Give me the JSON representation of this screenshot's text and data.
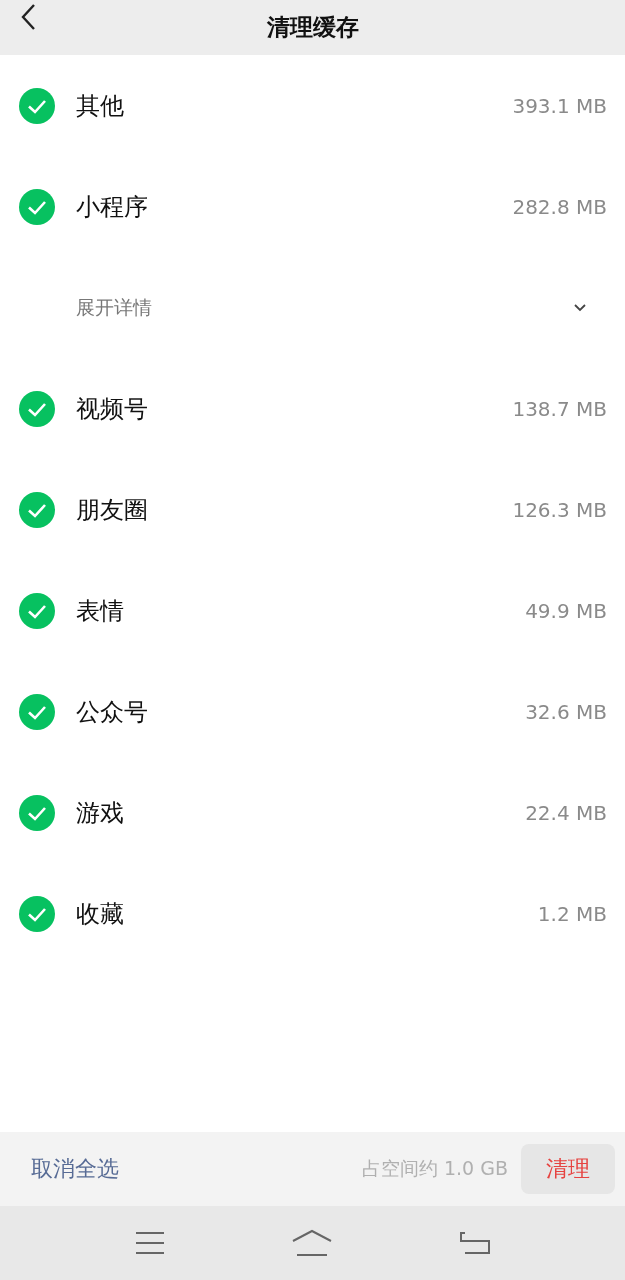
{
  "header": {
    "title": "清理缓存"
  },
  "items": [
    {
      "kind": "category",
      "label": "其他",
      "size": "393.1 MB",
      "checked": true
    },
    {
      "kind": "category",
      "label": "小程序",
      "size": "282.8 MB",
      "checked": true
    },
    {
      "kind": "expand",
      "label": "展开详情",
      "expanded": false
    },
    {
      "kind": "category",
      "label": "视频号",
      "size": "138.7 MB",
      "checked": true
    },
    {
      "kind": "category",
      "label": "朋友圈",
      "size": "126.3 MB",
      "checked": true
    },
    {
      "kind": "category",
      "label": "表情",
      "size": "49.9 MB",
      "checked": true
    },
    {
      "kind": "category",
      "label": "公众号",
      "size": "32.6 MB",
      "checked": true
    },
    {
      "kind": "category",
      "label": "游戏",
      "size": "22.4 MB",
      "checked": true
    },
    {
      "kind": "category",
      "label": "收藏",
      "size": "1.2 MB",
      "checked": true
    }
  ],
  "footer": {
    "deselect": "取消全选",
    "summary": "占空间约 1.0 GB",
    "clean": "清理"
  }
}
